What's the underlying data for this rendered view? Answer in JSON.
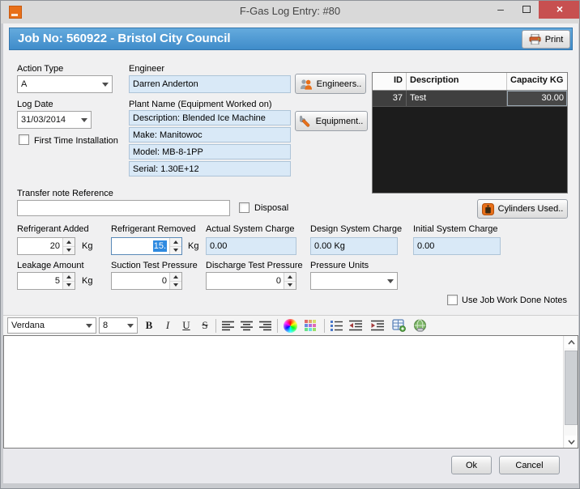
{
  "window": {
    "title": "F-Gas Log Entry: #80",
    "minimize_glyph": "–",
    "close_glyph": "×"
  },
  "header": {
    "title": "Job No: 560922 - Bristol City Council",
    "print_label": "Print"
  },
  "form": {
    "action_type": {
      "label": "Action Type",
      "value": "A"
    },
    "log_date": {
      "label": "Log Date",
      "value": "31/03/2014"
    },
    "first_time_installation_label": "First Time Installation",
    "first_time_installation_checked": false,
    "engineer": {
      "label": "Engineer",
      "value": "Darren Anderton"
    },
    "engineers_button_label": "Engineers..",
    "plant_label": "Plant Name (Equipment Worked on)",
    "plant_rows": [
      "Description: Blended Ice Machine",
      "Make: Manitowoc",
      "Model: MB-8-1PP",
      "Serial: 1.30E+12"
    ],
    "equipment_button_label": "Equipment..",
    "transfer_note_label": "Transfer note Reference",
    "transfer_note_value": "",
    "disposal_label": "Disposal",
    "disposal_checked": false,
    "cylinders_button_label": "Cylinders Used..",
    "refrigerant_added": {
      "label": "Refrigerant Added",
      "value": "20",
      "unit": "Kg"
    },
    "refrigerant_removed": {
      "label": "Refrigerant Removed",
      "value": "15.",
      "unit": "Kg",
      "selected": true
    },
    "actual_system_charge": {
      "label": "Actual System Charge",
      "value": "0.00"
    },
    "design_system_charge": {
      "label": "Design System Charge",
      "value": "0.00 Kg"
    },
    "initial_system_charge": {
      "label": "Initial System Charge",
      "value": "0.00"
    },
    "leakage_amount": {
      "label": "Leakage Amount",
      "value": "5",
      "unit": "Kg"
    },
    "suction_test_pressure": {
      "label": "Suction Test Pressure",
      "value": "0"
    },
    "discharge_test_pressure": {
      "label": "Discharge Test Pressure",
      "value": "0"
    },
    "pressure_units": {
      "label": "Pressure Units",
      "value": ""
    },
    "use_job_notes_label": "Use Job Work Done Notes",
    "use_job_notes_checked": false
  },
  "cylinders_table": {
    "headers": {
      "id": "ID",
      "description": "Description",
      "capacity": "Capacity KG"
    },
    "rows": [
      {
        "id": "37",
        "description": "Test",
        "capacity": "30.00"
      }
    ]
  },
  "editor": {
    "font_name": "Verdana",
    "font_size": "8",
    "toolbar": {
      "bold": "B",
      "italic": "I",
      "underline": "U",
      "strike": "S"
    },
    "content": ""
  },
  "footer": {
    "ok_label": "Ok",
    "cancel_label": "Cancel"
  },
  "icons": {
    "app": "orange-square-logo",
    "print": "printer",
    "engineers": "two-people",
    "equipment": "wrench",
    "cylinders": "gas-cylinder",
    "editor": [
      "bold",
      "italic",
      "underline",
      "strikethrough",
      "align-left",
      "align-center",
      "align-right",
      "color-wheel",
      "color-grid",
      "bullet-list",
      "indent-decrease",
      "indent-increase",
      "insert-table",
      "insert-link-globe"
    ]
  },
  "colors": {
    "header_blue_top": "#64aadd",
    "header_blue_bottom": "#3f8cca",
    "field_blue": "#d9e9f7",
    "selection_blue": "#2f8ae0",
    "close_red": "#c75050",
    "accent_orange": "#e8701a",
    "table_row_bg": "#3f3f3f",
    "table_body_bg": "#1c1c1c",
    "dialog_bg": "#f0f0f1"
  }
}
